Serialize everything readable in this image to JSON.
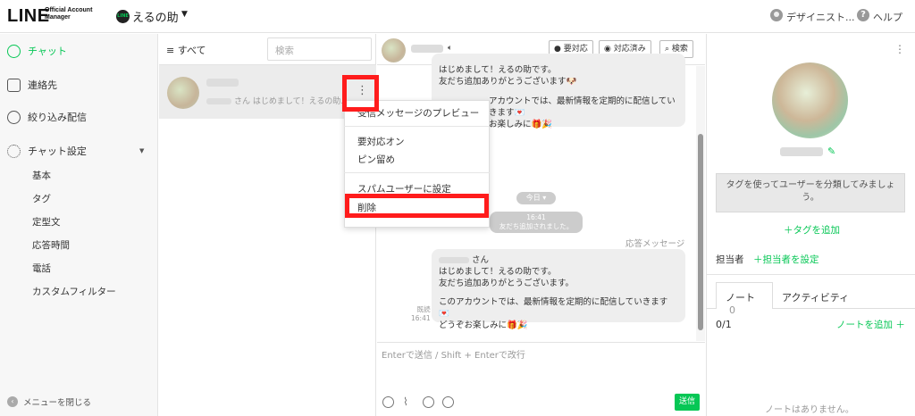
{
  "header": {
    "logo": "LINE",
    "logo_sub_1": "Official Account",
    "logo_sub_2": "Manager",
    "account_badge": "LINE",
    "account_name": "えるの助",
    "user_name": "デザイニスト...",
    "help_label": "ヘルプ"
  },
  "sidebar": {
    "items": [
      {
        "label": "チャット",
        "active": true
      },
      {
        "label": "連絡先"
      },
      {
        "label": "絞り込み配信"
      },
      {
        "label": "チャット設定"
      }
    ],
    "sub_items": [
      "基本",
      "タグ",
      "定型文",
      "応答時間",
      "電話",
      "カスタムフィルター"
    ],
    "close_menu": "メニューを閉じる"
  },
  "chat_list": {
    "filter_label": "≡ すべて",
    "search_placeholder": "検索",
    "items": [
      {
        "preview": "さん はじめまして！えるの助..."
      }
    ]
  },
  "context_menu": {
    "items": [
      "受信メッセージのプレビュー",
      "要対応オン",
      "ピン留め",
      "スパムユーザーに設定",
      "削除"
    ]
  },
  "chat_header": {
    "buttons": [
      "要対応",
      "対応済み",
      "検索"
    ]
  },
  "messages": {
    "top_bubble": {
      "line1": "はじめまして！えるの助です。",
      "line2": "友だち追加ありがとうございます",
      "line3": "アカウントでは、最新情報を定期的に配信していきます",
      "line4": "お楽しみに"
    },
    "date_chip": "今日 ▾",
    "system_time": "16:41",
    "system_text": "友だち追加されました。",
    "auto_label": "応答メッセージ",
    "bottom_bubble": {
      "line0": "さん",
      "line1": "はじめまして！えるの助です。",
      "line2": "友だち追加ありがとうございます。",
      "line3": "このアカウントでは、最新情報を定期的に配信していきます",
      "line4": "どうぞお楽しみに"
    },
    "read_label": "既読",
    "read_time": "16:41"
  },
  "input": {
    "placeholder": "Enterで送信 / Shift + Enterで改行",
    "send_label": "送信"
  },
  "profile": {
    "tag_hint": "タグを使ってユーザーを分類してみましょう。",
    "add_tag": "＋タグを追加",
    "assignee_label": "担当者",
    "set_assignee": "＋担当者を設定",
    "tab_note": "ノート",
    "tab_note_count": "0",
    "tab_activity": "アクティビティ",
    "note_count": "0/1",
    "add_note": "ノートを追加 ＋",
    "no_notes": "ノートはありません。"
  },
  "colors": {
    "accent": "#06c755",
    "highlight": "#ff1c1c"
  }
}
